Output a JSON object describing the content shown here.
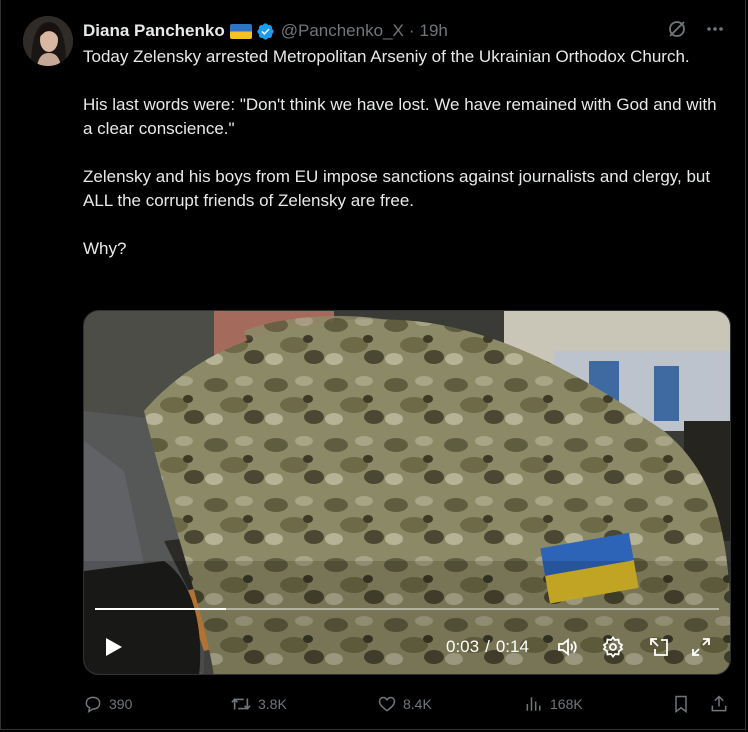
{
  "author": {
    "name": "Diana Panchenko",
    "handle": "@Panchenko_X",
    "separator": "·",
    "time": "19h"
  },
  "icons": {
    "verified": "verified-badge-icon",
    "flag": "ukraine-flag-icon",
    "grok": "grok-icon",
    "more": "more-icon"
  },
  "post": {
    "paragraphs": [
      "Today Zelensky arrested Metropolitan Arseniy of the Ukrainian Orthodox Church.",
      "His last words were: \"Don't think we have lost. We have remained with God and with a clear conscience.\"",
      "Zelensky and his boys from EU impose sanctions against journalists and clergy, but ALL the corrupt friends of Zelensky are free.",
      "Why?"
    ]
  },
  "video": {
    "current_time": "0:03",
    "separator": "/",
    "duration": "0:14",
    "progress_fraction": 0.21
  },
  "actions": {
    "replies": "390",
    "reposts": "3.8K",
    "likes": "8.4K",
    "views": "168K"
  },
  "colors": {
    "background": "#000000",
    "text": "#e7e9ea",
    "muted": "#71767b",
    "verified": "#1d9bf0",
    "border": "#2f3336"
  }
}
